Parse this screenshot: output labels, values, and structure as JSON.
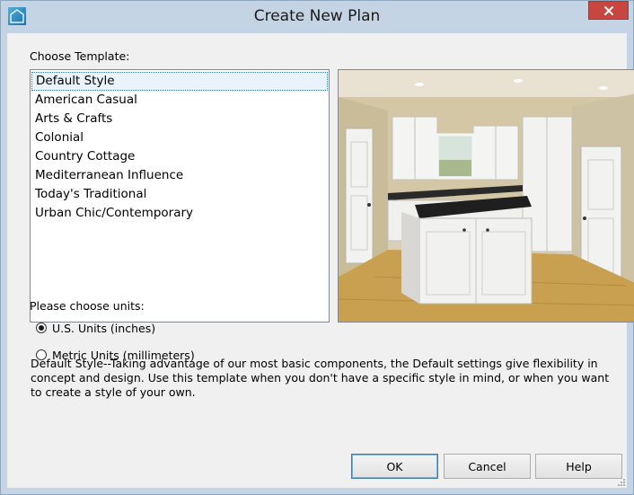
{
  "window": {
    "title": "Create New Plan"
  },
  "template_section": {
    "label": "Choose Template:",
    "items": [
      "Default Style",
      "American Casual",
      "Arts & Crafts",
      "Colonial",
      "Country Cottage",
      "Mediterranean Influence",
      "Today's Traditional",
      "Urban Chic/Contemporary"
    ],
    "selected_index": 0
  },
  "units_section": {
    "label": "Please choose units:",
    "options": [
      {
        "label": "U.S. Units (inches)",
        "checked": true
      },
      {
        "label": "Metric Units (millimeters)",
        "checked": false
      }
    ]
  },
  "description": "Default Style--Taking advantage of our most basic components, the Default settings give flexibility in concept and design. Use this template when you don't have a specific style in mind, or when you want to create a style of your own.",
  "buttons": {
    "ok": "OK",
    "cancel": "Cancel",
    "help": "Help"
  },
  "icons": {
    "app": "app-logo-icon",
    "close": "close-icon",
    "grip": "resize-grip-icon"
  },
  "colors": {
    "title_bar": "#c5d4e4",
    "close_button": "#c7463f",
    "dialog_background": "#f0f0f0",
    "selection": "#eaf3fc"
  }
}
